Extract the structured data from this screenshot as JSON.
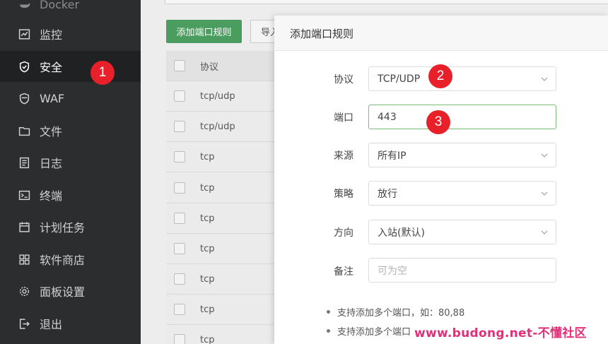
{
  "sidebar": {
    "items": [
      {
        "label": "Docker",
        "icon": "docker-icon",
        "active": false
      },
      {
        "label": "监控",
        "icon": "monitor-icon",
        "active": false
      },
      {
        "label": "安全",
        "icon": "shield-icon",
        "active": true
      },
      {
        "label": "WAF",
        "icon": "waf-shield-icon",
        "active": false
      },
      {
        "label": "文件",
        "icon": "folder-icon",
        "active": false
      },
      {
        "label": "日志",
        "icon": "log-icon",
        "active": false
      },
      {
        "label": "终端",
        "icon": "terminal-icon",
        "active": false
      },
      {
        "label": "计划任务",
        "icon": "calendar-icon",
        "active": false
      },
      {
        "label": "软件商店",
        "icon": "grid-icon",
        "active": false
      },
      {
        "label": "面板设置",
        "icon": "gear-icon",
        "active": false
      },
      {
        "label": "退出",
        "icon": "logout-icon",
        "active": false
      }
    ]
  },
  "toolbar": {
    "add_label": "添加端口规则",
    "import_label": "导入"
  },
  "table": {
    "header": "协议",
    "rows": [
      "tcp/udp",
      "tcp/udp",
      "tcp",
      "tcp",
      "tcp",
      "tcp",
      "tcp",
      "tcp",
      "tcp"
    ]
  },
  "modal": {
    "title": "添加端口规则",
    "fields": {
      "protocol": {
        "label": "协议",
        "value": "TCP/UDP"
      },
      "port": {
        "label": "端口",
        "value": "443"
      },
      "source": {
        "label": "来源",
        "value": "所有IP"
      },
      "strategy": {
        "label": "策略",
        "value": "放行"
      },
      "direction": {
        "label": "方向",
        "value": "入站(默认)"
      },
      "remark": {
        "label": "备注",
        "placeholder": "可为空"
      }
    },
    "tips": [
      "支持添加多个端口，如：80,88",
      "支持添加多个端口"
    ]
  },
  "badges": [
    "1",
    "2",
    "3"
  ],
  "watermark": "www.budong.net-不懂社区",
  "colors": {
    "sidebar_bg": "#2b2d2f",
    "accent_green": "#2f8f47",
    "badge_red": "#e8202a"
  }
}
